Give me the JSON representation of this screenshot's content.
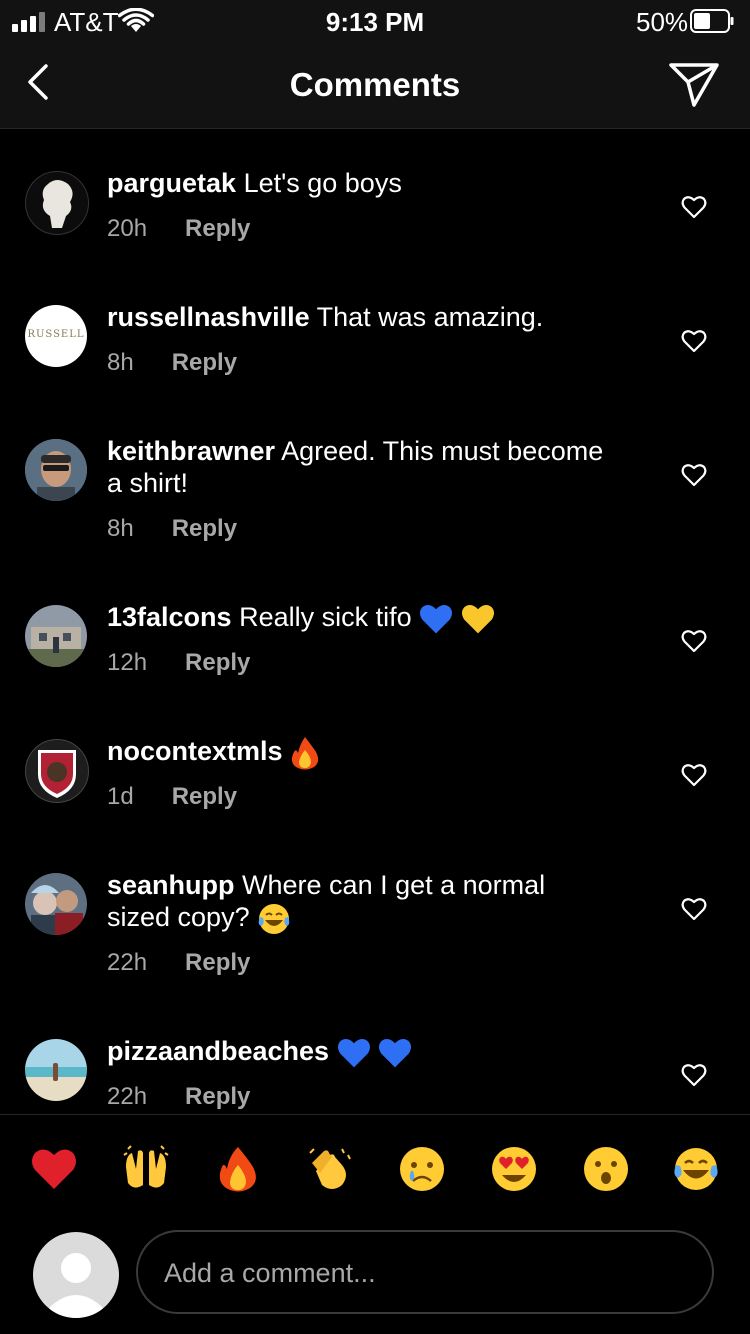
{
  "status_bar": {
    "carrier": "AT&T",
    "time": "9:13 PM",
    "battery": "50%"
  },
  "header": {
    "title": "Comments",
    "back_icon": "chevron-left-icon",
    "share_icon": "paper-plane-icon"
  },
  "comments": [
    {
      "username": "parguetak",
      "text": "Let's go boys",
      "time": "20h",
      "reply": "Reply",
      "emojis": []
    },
    {
      "username": "russellnashville",
      "text": "That was amazing.",
      "time": "8h",
      "reply": "Reply",
      "emojis": [],
      "avatar_text": "RUSSELL"
    },
    {
      "username": "keithbrawner",
      "text": "Agreed.  This must become a shirt!",
      "time": "8h",
      "reply": "Reply",
      "emojis": []
    },
    {
      "username": "13falcons",
      "text": "Really sick tifo",
      "time": "12h",
      "reply": "Reply",
      "emojis": [
        "blue-heart",
        "yellow-heart"
      ]
    },
    {
      "username": "nocontextmls",
      "text": "",
      "time": "1d",
      "reply": "Reply",
      "emojis": [
        "fire"
      ]
    },
    {
      "username": "seanhupp",
      "text": "Where can I get a normal sized copy?",
      "time": "22h",
      "reply": "Reply",
      "emojis": [
        "tears-of-joy"
      ]
    },
    {
      "username": "pizzaandbeaches",
      "text": "",
      "time": "22h",
      "reply": "Reply",
      "emojis": [
        "blue-heart",
        "blue-heart"
      ]
    }
  ],
  "emoji_bar": [
    "red-heart",
    "raising-hands",
    "fire",
    "clapping-hands",
    "crying-face",
    "heart-eyes",
    "surprised-face",
    "tears-of-joy"
  ],
  "comment_input": {
    "placeholder": "Add a comment..."
  },
  "colors": {
    "background": "#000000",
    "bar": "#121212",
    "secondary_text": "#a8a8a8",
    "blue_heart": "#2f6ff3",
    "yellow_heart": "#f9c72c"
  }
}
